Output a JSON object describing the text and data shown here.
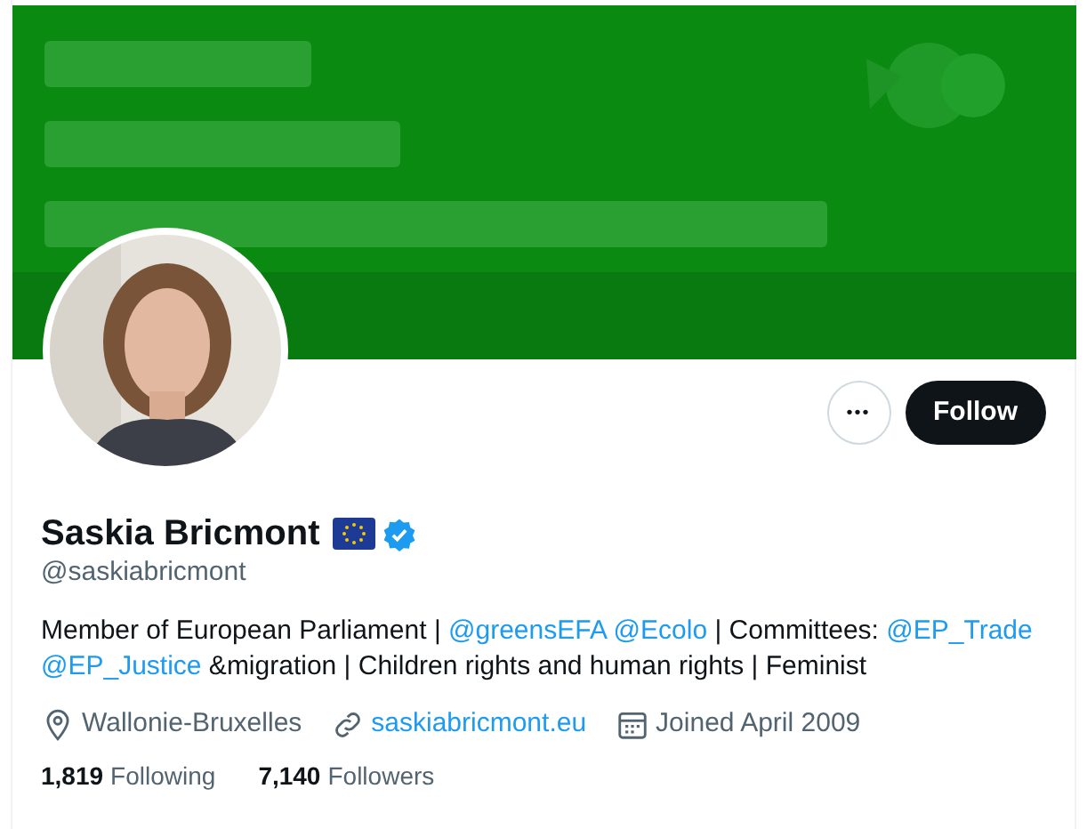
{
  "actions": {
    "more": "•••",
    "follow": "Follow"
  },
  "profile": {
    "name": "Saskia Bricmont",
    "verified": true,
    "handle": "@saskiabricmont"
  },
  "bio": [
    {
      "kind": "text",
      "text": "Member of European Parliament | "
    },
    {
      "kind": "link",
      "text": "@greensEFA",
      "space_after": true
    },
    {
      "kind": "link",
      "text": "@Ecolo"
    },
    {
      "kind": "text",
      "text": " | Committees: "
    },
    {
      "kind": "link",
      "text": "@EP_Trade",
      "space_after": true
    },
    {
      "kind": "link",
      "text": "@EP_Justice"
    },
    {
      "kind": "text",
      "text": " &migration | Children rights and human rights | Feminist"
    }
  ],
  "meta": [
    {
      "kind": "location",
      "text": "Wallonie-Bruxelles"
    },
    {
      "kind": "url",
      "text": "saskiabricmont.eu"
    },
    {
      "kind": "joined",
      "text": "Joined April 2009"
    }
  ],
  "stats": [
    {
      "count": "1,819",
      "label": "Following"
    },
    {
      "count": "7,140",
      "label": "Followers"
    }
  ]
}
